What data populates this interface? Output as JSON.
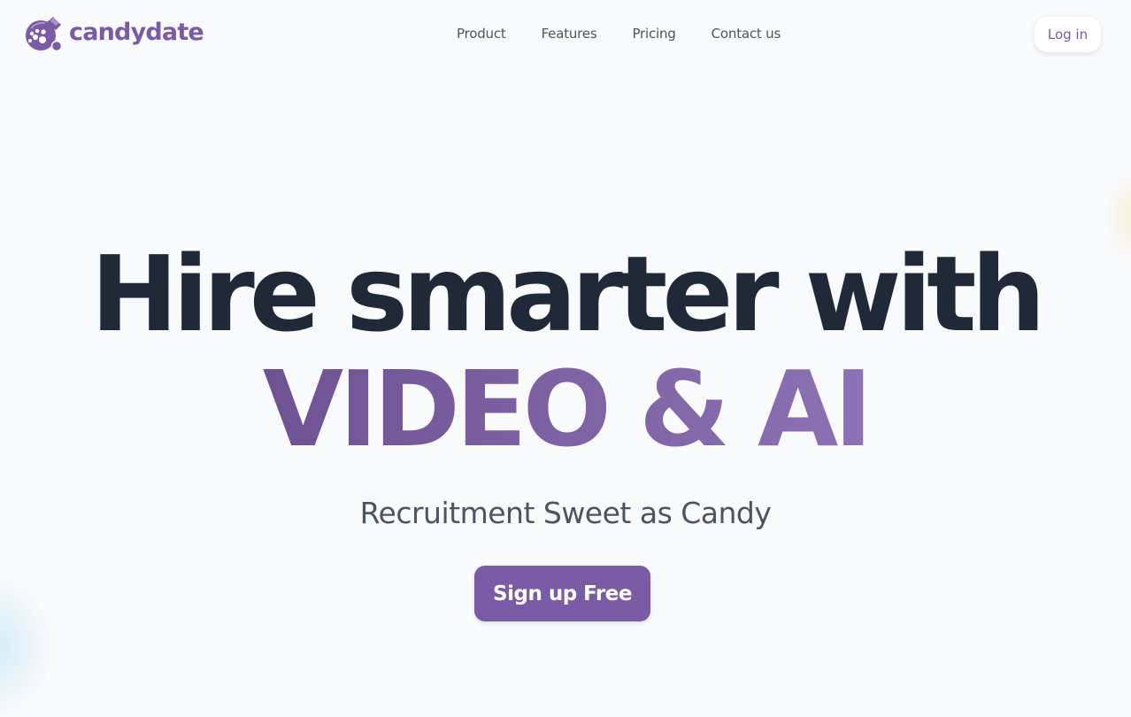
{
  "brand": {
    "name": "candydate",
    "logo_icon": "candy-jar-icon",
    "color": "#7b5aa6"
  },
  "nav": {
    "items": [
      {
        "label": "Product"
      },
      {
        "label": "Features"
      },
      {
        "label": "Pricing"
      },
      {
        "label": "Contact us"
      }
    ],
    "login_label": "Log in"
  },
  "hero": {
    "headline_line1": "Hire smarter with",
    "headline_line2": "VIDEO & AI",
    "subtitle": "Recruitment Sweet as Candy",
    "cta_label": "Sign up Free"
  },
  "colors": {
    "background": "#f8fafc",
    "headline": "#1f2937",
    "accent_gradient_start": "#6f5294",
    "accent_gradient_end": "#8c72b4",
    "text_muted": "#4b5563"
  }
}
